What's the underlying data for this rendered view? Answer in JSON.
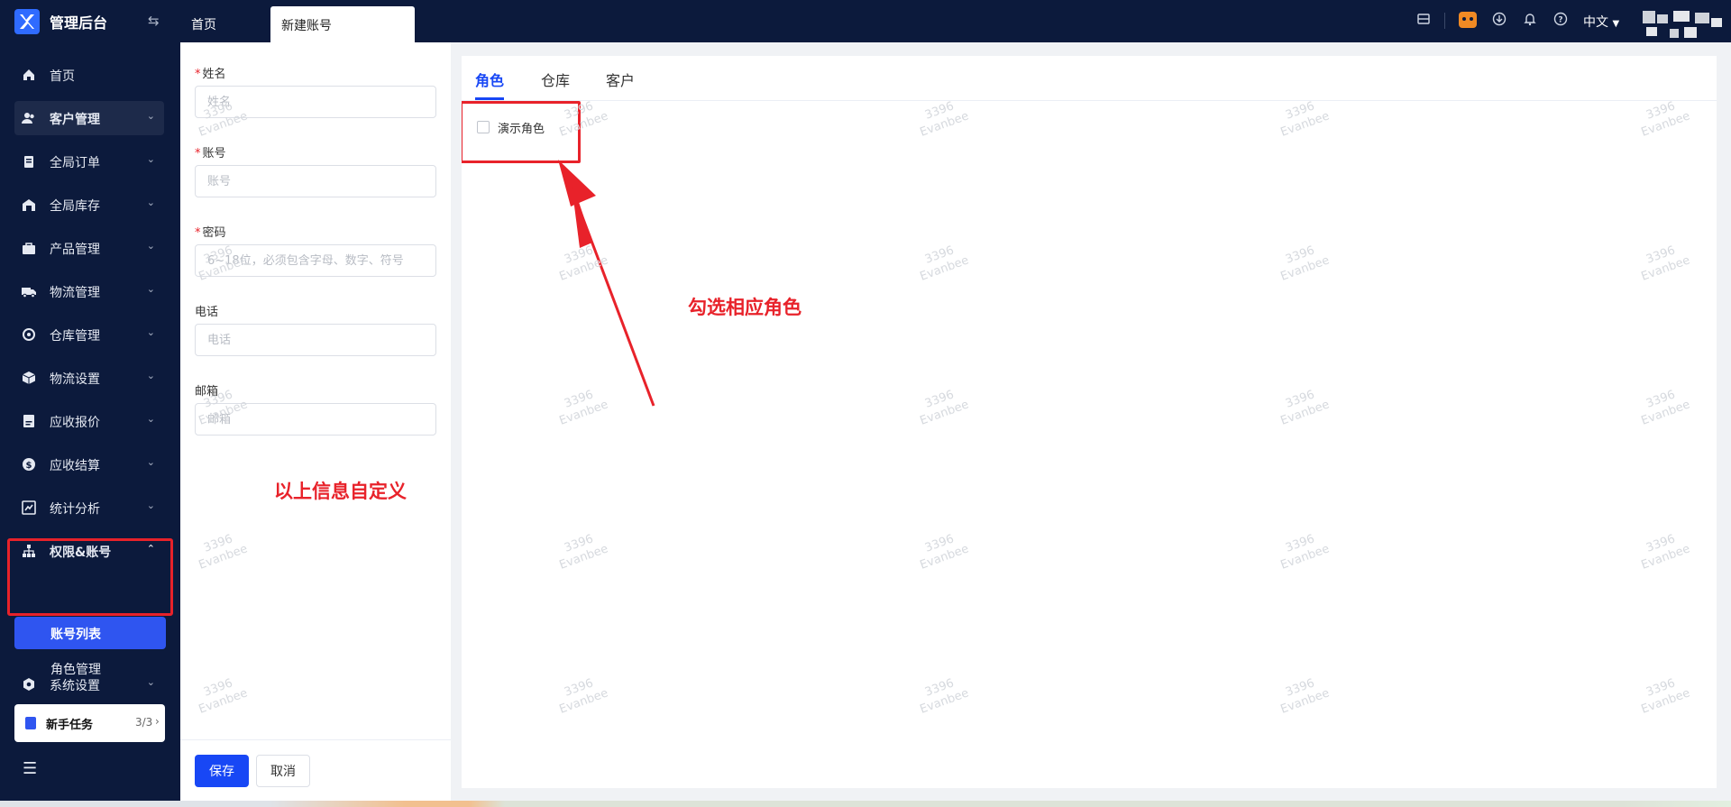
{
  "header": {
    "app_title": "管理后台",
    "tabs": [
      {
        "label": "首页"
      },
      {
        "label": "新建账号"
      }
    ],
    "language": "中文",
    "icons": [
      "store-icon",
      "robot-icon",
      "download-icon",
      "bell-icon",
      "help-icon"
    ]
  },
  "sidebar": {
    "items": [
      {
        "label": "首页",
        "icon": "home-icon"
      },
      {
        "label": "客户管理",
        "icon": "customers-icon"
      },
      {
        "label": "全局订单",
        "icon": "orders-icon"
      },
      {
        "label": "全局库存",
        "icon": "inventory-icon"
      },
      {
        "label": "产品管理",
        "icon": "product-icon"
      },
      {
        "label": "物流管理",
        "icon": "truck-icon"
      },
      {
        "label": "仓库管理",
        "icon": "warehouse-icon"
      },
      {
        "label": "物流设置",
        "icon": "box-icon"
      },
      {
        "label": "应收报价",
        "icon": "quote-icon"
      },
      {
        "label": "应收结算",
        "icon": "dollar-icon"
      },
      {
        "label": "统计分析",
        "icon": "chart-icon"
      },
      {
        "label": "权限&账号",
        "icon": "org-icon"
      },
      {
        "label": "系统设置",
        "icon": "settings-icon"
      }
    ],
    "sub_items": [
      {
        "label": "账号列表"
      },
      {
        "label": "角色管理"
      }
    ],
    "task_card": {
      "label": "新手任务",
      "count": "3/3"
    }
  },
  "form": {
    "fields": [
      {
        "label": "姓名",
        "required": true,
        "placeholder": "姓名",
        "value": ""
      },
      {
        "label": "账号",
        "required": true,
        "placeholder": "账号",
        "value": ""
      },
      {
        "label": "密码",
        "required": true,
        "placeholder": "6~18位，必须包含字母、数字、符号",
        "value": ""
      },
      {
        "label": "电话",
        "required": false,
        "placeholder": "电话",
        "value": ""
      },
      {
        "label": "邮箱",
        "required": false,
        "placeholder": "邮箱",
        "value": ""
      }
    ],
    "note": "以上信息自定义",
    "save_label": "保存",
    "cancel_label": "取消"
  },
  "assign": {
    "tabs": [
      {
        "label": "角色"
      },
      {
        "label": "仓库"
      },
      {
        "label": "客户"
      }
    ],
    "active_tab": "角色",
    "roles": [
      {
        "label": "演示角色",
        "checked": false
      }
    ],
    "annotation": "勾选相应角色"
  },
  "watermark": {
    "line1": "3396",
    "line2": "Evanbee"
  },
  "colors": {
    "accent": "#1847f5",
    "sidebar_bg": "#0c1a3c",
    "annotation_red": "#e8222a"
  }
}
